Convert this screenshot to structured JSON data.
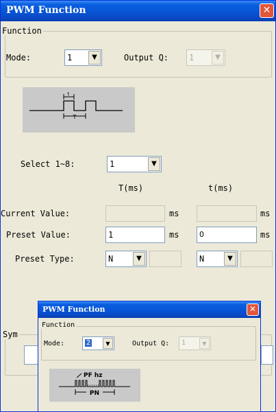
{
  "window": {
    "title": "PWM Function",
    "close_glyph": "✕"
  },
  "function_group": {
    "legend": "Function",
    "mode_label": "Mode:",
    "mode_value": "1",
    "output_label": "Output Q:",
    "output_value": "1"
  },
  "diagram": {
    "t_label": "t",
    "T_label": "T"
  },
  "select": {
    "label": "Select 1~8:",
    "value": "1"
  },
  "columns": {
    "T": "T(ms)",
    "t": "t(ms)"
  },
  "rows": {
    "current_label": "Current Value:",
    "preset_label": "Preset Value:",
    "type_label": "Preset Type:",
    "unit": "ms",
    "current_T": "",
    "current_t": "",
    "preset_T": "1",
    "preset_t": "0",
    "type_T": "N",
    "type_t": "N"
  },
  "symbol_group": {
    "legend_partial": "Sym"
  },
  "popup": {
    "title": "PWM Function",
    "legend": "Function",
    "mode_label": "Mode:",
    "mode_value": "2",
    "output_label": "Output Q:",
    "output_value": "1",
    "diagram_top": "PF hz",
    "diagram_bottom": "PN"
  }
}
